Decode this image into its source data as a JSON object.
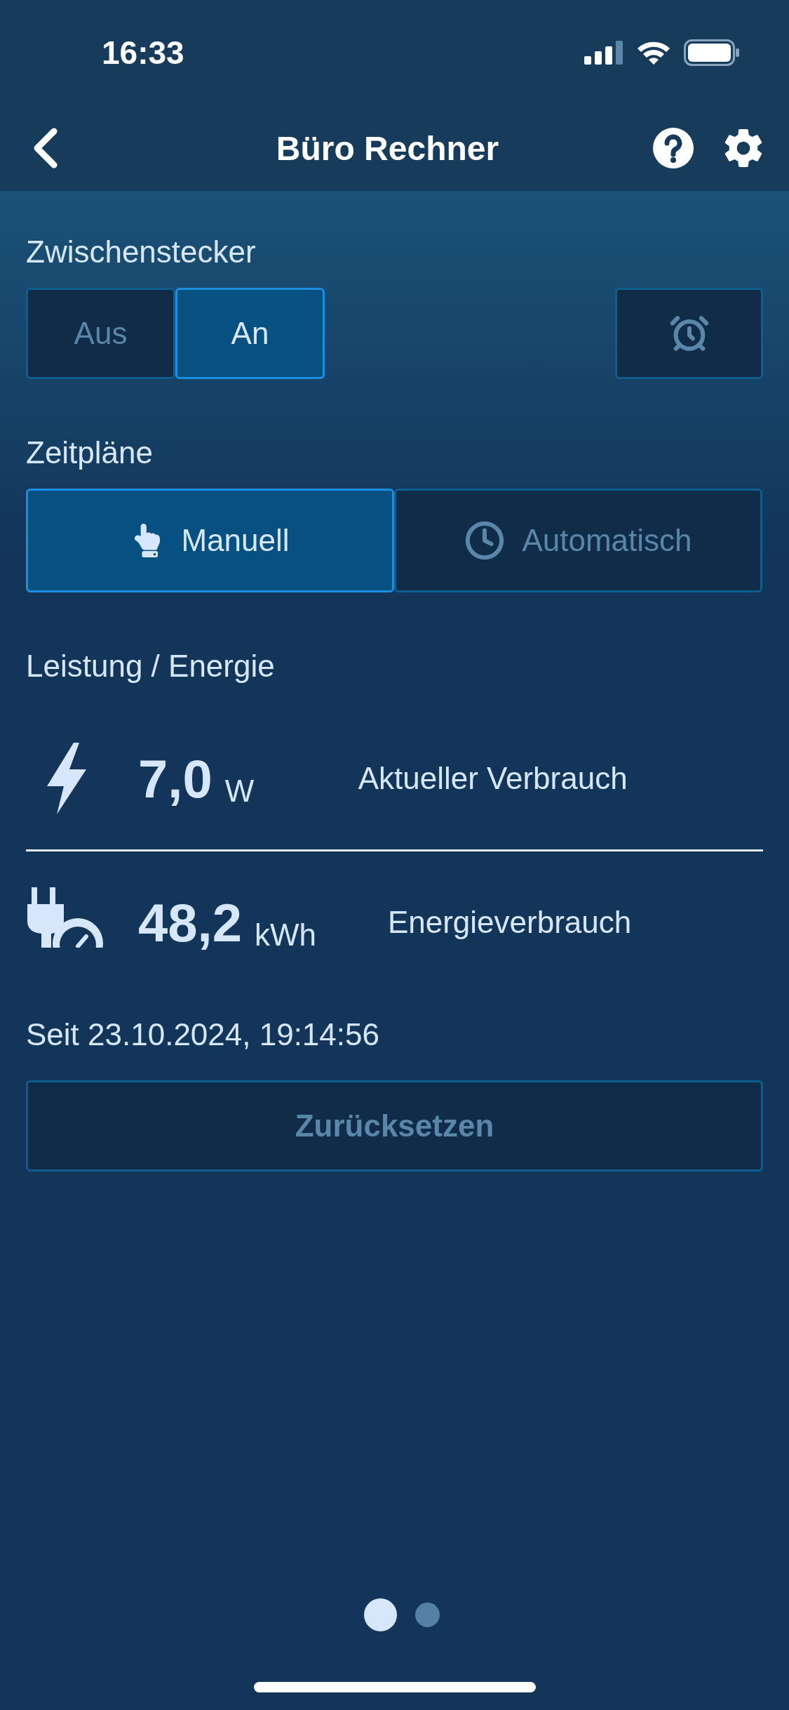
{
  "status_bar": {
    "time": "16:33"
  },
  "nav": {
    "title": "Büro Rechner"
  },
  "plug_switch": {
    "label": "Zwischenstecker",
    "options": [
      {
        "label": "Aus",
        "selected": false
      },
      {
        "label": "An",
        "selected": true
      }
    ]
  },
  "schedules": {
    "label": "Zeitpläne",
    "options": [
      {
        "label": "Manuell",
        "selected": true,
        "kind": "hand"
      },
      {
        "label": "Automatisch",
        "selected": false,
        "kind": "clock"
      }
    ]
  },
  "energy": {
    "heading": "Leistung / Energie",
    "rows": [
      {
        "kind": "power",
        "value": "7,0",
        "unit": "W",
        "label": "Aktueller Verbrauch"
      },
      {
        "kind": "energy",
        "value": "48,2",
        "unit": "kWh",
        "label": "Energieverbrauch"
      }
    ],
    "since": "Seit 23.10.2024, 19:14:56",
    "reset_button": {
      "label": "Zurücksetzen",
      "disabled": true
    }
  },
  "pager": {
    "dots": [
      {
        "selected": true
      },
      {
        "selected": false
      }
    ]
  }
}
